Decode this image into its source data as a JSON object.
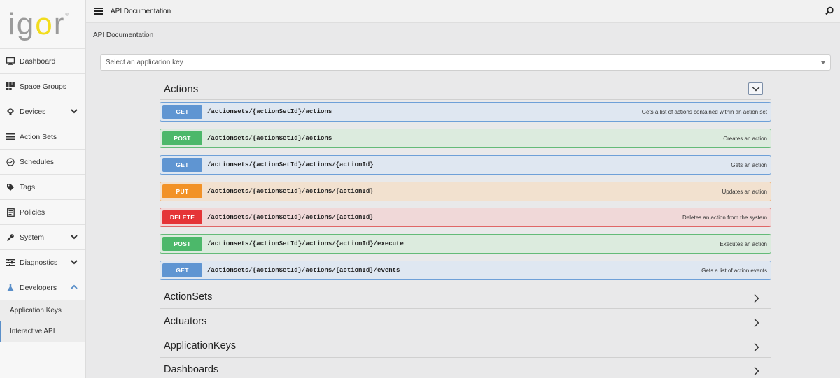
{
  "sidebar": {
    "logo_letters": [
      "i",
      "g",
      "o",
      "r"
    ],
    "logo_mark": "®",
    "items": [
      {
        "label": "Dashboard",
        "icon": "monitor-icon",
        "expandable": false
      },
      {
        "label": "Space Groups",
        "icon": "grid-icon",
        "expandable": false
      },
      {
        "label": "Devices",
        "icon": "lightbulb-icon",
        "expandable": true,
        "expanded": false
      },
      {
        "label": "Action Sets",
        "icon": "list-icon",
        "expandable": false
      },
      {
        "label": "Schedules",
        "icon": "clock-icon",
        "expandable": false
      },
      {
        "label": "Tags",
        "icon": "tag-icon",
        "expandable": false
      },
      {
        "label": "Policies",
        "icon": "document-icon",
        "expandable": false
      },
      {
        "label": "System",
        "icon": "wrench-icon",
        "expandable": true,
        "expanded": false
      },
      {
        "label": "Diagnostics",
        "icon": "sliders-icon",
        "expandable": true,
        "expanded": false
      },
      {
        "label": "Developers",
        "icon": "flask-icon",
        "expandable": true,
        "expanded": true
      }
    ],
    "sub_items": [
      {
        "label": "Application Keys",
        "selected": false
      },
      {
        "label": "Interactive API",
        "selected": true
      }
    ]
  },
  "topbar": {
    "title": "API Documentation"
  },
  "breadcrumb": "API Documentation",
  "app_key_select": {
    "placeholder": "Select an application key"
  },
  "actions_section": {
    "title": "Actions",
    "operations": [
      {
        "method": "GET",
        "path": "/actionsets/{actionSetId}/actions",
        "description": "Gets a list of actions contained within an action set"
      },
      {
        "method": "POST",
        "path": "/actionsets/{actionSetId}/actions",
        "description": "Creates an action"
      },
      {
        "method": "GET",
        "path": "/actionsets/{actionSetId}/actions/{actionId}",
        "description": "Gets an action"
      },
      {
        "method": "PUT",
        "path": "/actionsets/{actionSetId}/actions/{actionId}",
        "description": "Updates an action"
      },
      {
        "method": "DELETE",
        "path": "/actionsets/{actionSetId}/actions/{actionId}",
        "description": "Deletes an action from the system"
      },
      {
        "method": "POST",
        "path": "/actionsets/{actionSetId}/actions/{actionId}/execute",
        "description": "Executes an action"
      },
      {
        "method": "GET",
        "path": "/actionsets/{actionSetId}/actions/{actionId}/events",
        "description": "Gets a list of action events"
      }
    ]
  },
  "sections": [
    "ActionSets",
    "Actuators",
    "ApplicationKeys",
    "Dashboards"
  ],
  "colors": {
    "get": "#5f95d2",
    "post": "#4cb86a",
    "put": "#f29227",
    "delete": "#e53437",
    "logo_accent": "#f2dc1d",
    "nav_accent": "#5a8fc9"
  }
}
